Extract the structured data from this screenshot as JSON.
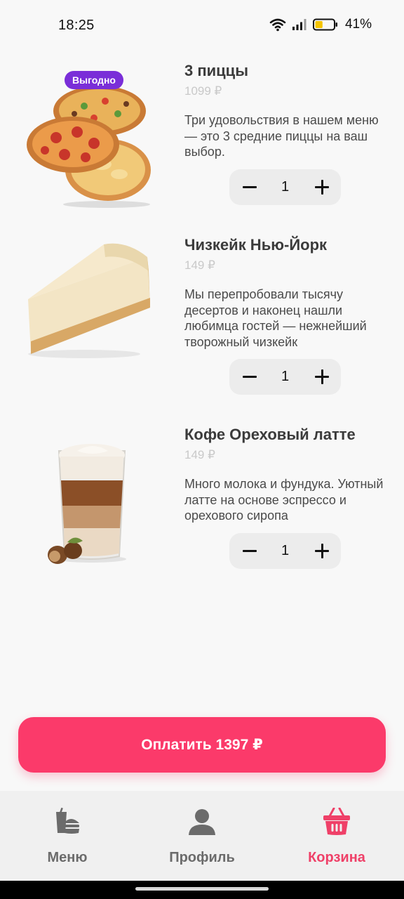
{
  "status_bar": {
    "time": "18:25",
    "battery_percent": "41%",
    "battery_level": 0.41,
    "icons": [
      "wifi-icon",
      "signal-icon",
      "battery-icon"
    ]
  },
  "products": [
    {
      "title": "3 пиццы",
      "price": "1099 ₽",
      "description": "Три удовольствия в нашем меню — это 3 средние пиццы на ваш выбор.",
      "quantity": "1",
      "badge": "Выгодно",
      "image": "pizza-image"
    },
    {
      "title": "Чизкейк Нью-Йорк",
      "price": "149 ₽",
      "description": "Мы перепробовали тысячу десертов и наконец нашли любимца гостей — нежнейший творожный чизкейк",
      "quantity": "1",
      "image": "cheesecake-image"
    },
    {
      "title": "Кофе Ореховый латте",
      "price": "149 ₽",
      "description": "Много молока и фундука. Уютный латте на основе эспрессо и орехового сиропа",
      "quantity": "1",
      "image": "latte-image"
    }
  ],
  "pay_button": {
    "label": "Оплатить 1397 ₽"
  },
  "bottom_nav": [
    {
      "label": "Меню",
      "icon": "food-icon",
      "active": false
    },
    {
      "label": "Профиль",
      "icon": "user-icon",
      "active": false
    },
    {
      "label": "Корзина",
      "icon": "basket-icon",
      "active": true
    }
  ],
  "colors": {
    "accent": "#fb3a6a",
    "badge": "#7a2ed8",
    "nav_active": "#ef4068",
    "battery_fill": "#f5c400"
  }
}
